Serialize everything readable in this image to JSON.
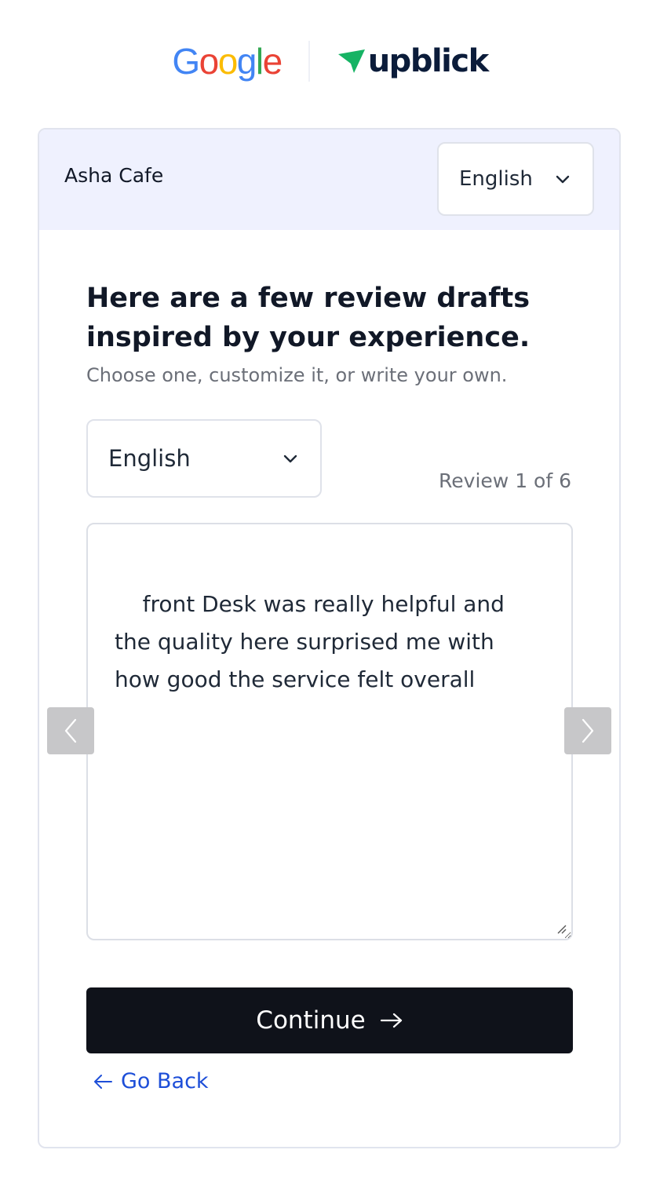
{
  "brand": {
    "google_letters": [
      {
        "char": "G",
        "color": "#4285F4"
      },
      {
        "char": "o",
        "color": "#EA4335"
      },
      {
        "char": "o",
        "color": "#FBBC05"
      },
      {
        "char": "g",
        "color": "#4285F4"
      },
      {
        "char": "l",
        "color": "#34A853"
      },
      {
        "char": "e",
        "color": "#EA4335"
      }
    ],
    "partner_name": "upblick",
    "partner_icon_color": "#16b364"
  },
  "header": {
    "business_name": "Asha Cafe",
    "language": "English"
  },
  "main": {
    "headline": "Here are a few review drafts inspired by your experience.",
    "subtext": "Choose one, customize it, or write your own.",
    "language": "English",
    "review_counter": "Review 1 of 6",
    "review_text": "front Desk was really helpful and the quality here surprised me with how good the service felt overall"
  },
  "actions": {
    "continue_label": "Continue",
    "go_back_label": "Go Back"
  }
}
